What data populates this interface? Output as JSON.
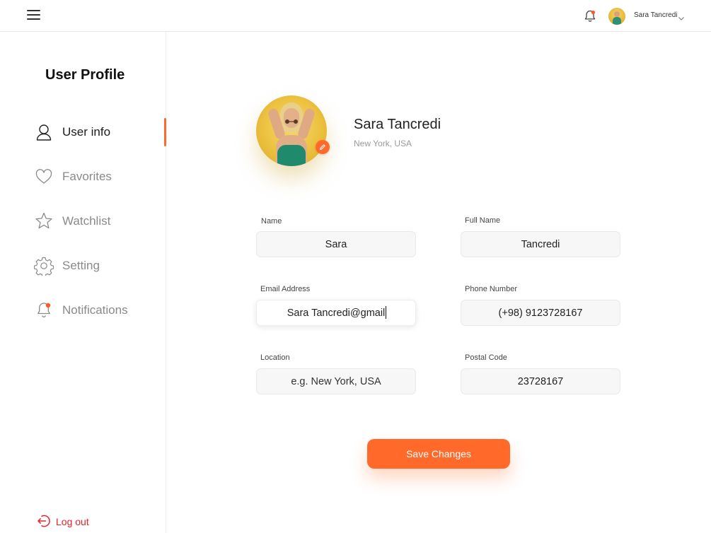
{
  "header": {
    "user_name": "Sara Tancredi"
  },
  "sidebar": {
    "title": "User Profile",
    "items": [
      {
        "label": "User info",
        "icon": "user-icon",
        "active": true
      },
      {
        "label": "Favorites",
        "icon": "heart-icon",
        "active": false
      },
      {
        "label": "Watchlist",
        "icon": "star-icon",
        "active": false
      },
      {
        "label": "Setting",
        "icon": "gear-icon",
        "active": false
      },
      {
        "label": "Notifications",
        "icon": "bell-icon",
        "active": false
      }
    ],
    "logout_label": "Log out"
  },
  "profile": {
    "name": "Sara Tancredi",
    "location": "New York, USA"
  },
  "form": {
    "name": {
      "label": "Name",
      "value": "Sara"
    },
    "full_name": {
      "label": "Full Name",
      "value": "Tancredi"
    },
    "email": {
      "label": "Email Address",
      "value": "Sara Tancredi@gmail"
    },
    "phone": {
      "label": "Phone Number",
      "value": "(+98) 9123728167"
    },
    "location": {
      "label": "Location",
      "placeholder": "e.g. New York, USA"
    },
    "postal": {
      "label": "Postal Code",
      "value": "23728167"
    },
    "save_label": "Save Changes"
  },
  "colors": {
    "accent": "#ff6a2b",
    "logout": "#e8202a",
    "notification_dot": "#ff5a1f"
  }
}
